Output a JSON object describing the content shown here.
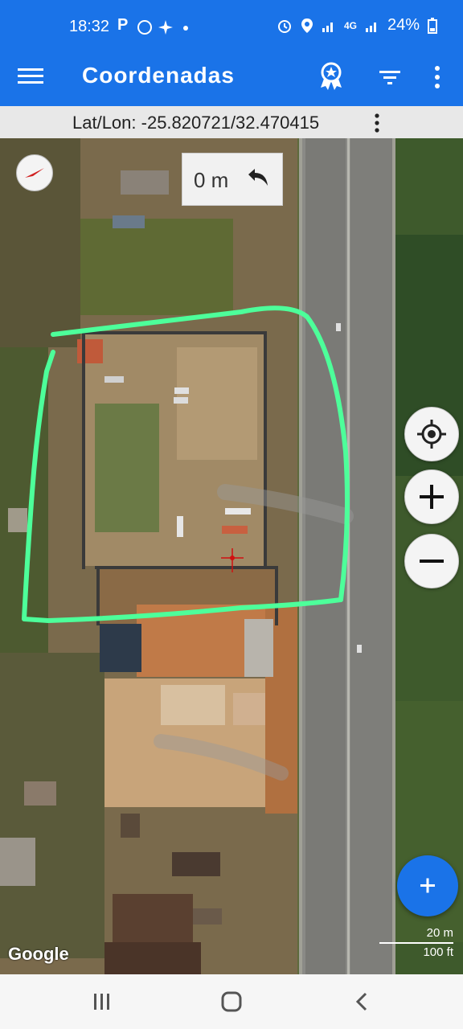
{
  "status_bar": {
    "time": "18:32",
    "left_icons": "P",
    "battery": "24%",
    "network": "4G"
  },
  "app_bar": {
    "title": "Coordenadas",
    "icons": [
      "menu-icon",
      "badge-icon",
      "filter-icon",
      "more-vert-icon"
    ]
  },
  "coords": {
    "label": "Lat/Lon: -25.820721/32.470415"
  },
  "map": {
    "distance": "0 m",
    "scale_metric": "20 m",
    "scale_imperial": "100 ft",
    "attribution": "Google",
    "colors": {
      "boundary": "#4dff9a",
      "fab": "#1a73e8"
    }
  },
  "nav_bar": {
    "icons": [
      "recents-icon",
      "home-icon",
      "back-icon"
    ]
  }
}
